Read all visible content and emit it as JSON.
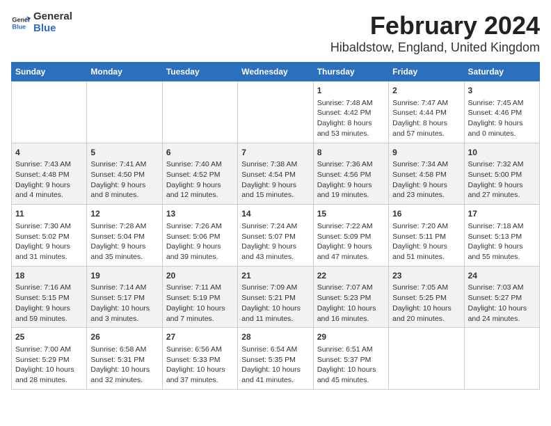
{
  "logo": {
    "line1": "General",
    "line2": "Blue"
  },
  "title": "February 2024",
  "subtitle": "Hibaldstow, England, United Kingdom",
  "days_of_week": [
    "Sunday",
    "Monday",
    "Tuesday",
    "Wednesday",
    "Thursday",
    "Friday",
    "Saturday"
  ],
  "weeks": [
    [
      {
        "day": "",
        "info": ""
      },
      {
        "day": "",
        "info": ""
      },
      {
        "day": "",
        "info": ""
      },
      {
        "day": "",
        "info": ""
      },
      {
        "day": "1",
        "info": "Sunrise: 7:48 AM\nSunset: 4:42 PM\nDaylight: 8 hours\nand 53 minutes."
      },
      {
        "day": "2",
        "info": "Sunrise: 7:47 AM\nSunset: 4:44 PM\nDaylight: 8 hours\nand 57 minutes."
      },
      {
        "day": "3",
        "info": "Sunrise: 7:45 AM\nSunset: 4:46 PM\nDaylight: 9 hours\nand 0 minutes."
      }
    ],
    [
      {
        "day": "4",
        "info": "Sunrise: 7:43 AM\nSunset: 4:48 PM\nDaylight: 9 hours\nand 4 minutes."
      },
      {
        "day": "5",
        "info": "Sunrise: 7:41 AM\nSunset: 4:50 PM\nDaylight: 9 hours\nand 8 minutes."
      },
      {
        "day": "6",
        "info": "Sunrise: 7:40 AM\nSunset: 4:52 PM\nDaylight: 9 hours\nand 12 minutes."
      },
      {
        "day": "7",
        "info": "Sunrise: 7:38 AM\nSunset: 4:54 PM\nDaylight: 9 hours\nand 15 minutes."
      },
      {
        "day": "8",
        "info": "Sunrise: 7:36 AM\nSunset: 4:56 PM\nDaylight: 9 hours\nand 19 minutes."
      },
      {
        "day": "9",
        "info": "Sunrise: 7:34 AM\nSunset: 4:58 PM\nDaylight: 9 hours\nand 23 minutes."
      },
      {
        "day": "10",
        "info": "Sunrise: 7:32 AM\nSunset: 5:00 PM\nDaylight: 9 hours\nand 27 minutes."
      }
    ],
    [
      {
        "day": "11",
        "info": "Sunrise: 7:30 AM\nSunset: 5:02 PM\nDaylight: 9 hours\nand 31 minutes."
      },
      {
        "day": "12",
        "info": "Sunrise: 7:28 AM\nSunset: 5:04 PM\nDaylight: 9 hours\nand 35 minutes."
      },
      {
        "day": "13",
        "info": "Sunrise: 7:26 AM\nSunset: 5:06 PM\nDaylight: 9 hours\nand 39 minutes."
      },
      {
        "day": "14",
        "info": "Sunrise: 7:24 AM\nSunset: 5:07 PM\nDaylight: 9 hours\nand 43 minutes."
      },
      {
        "day": "15",
        "info": "Sunrise: 7:22 AM\nSunset: 5:09 PM\nDaylight: 9 hours\nand 47 minutes."
      },
      {
        "day": "16",
        "info": "Sunrise: 7:20 AM\nSunset: 5:11 PM\nDaylight: 9 hours\nand 51 minutes."
      },
      {
        "day": "17",
        "info": "Sunrise: 7:18 AM\nSunset: 5:13 PM\nDaylight: 9 hours\nand 55 minutes."
      }
    ],
    [
      {
        "day": "18",
        "info": "Sunrise: 7:16 AM\nSunset: 5:15 PM\nDaylight: 9 hours\nand 59 minutes."
      },
      {
        "day": "19",
        "info": "Sunrise: 7:14 AM\nSunset: 5:17 PM\nDaylight: 10 hours\nand 3 minutes."
      },
      {
        "day": "20",
        "info": "Sunrise: 7:11 AM\nSunset: 5:19 PM\nDaylight: 10 hours\nand 7 minutes."
      },
      {
        "day": "21",
        "info": "Sunrise: 7:09 AM\nSunset: 5:21 PM\nDaylight: 10 hours\nand 11 minutes."
      },
      {
        "day": "22",
        "info": "Sunrise: 7:07 AM\nSunset: 5:23 PM\nDaylight: 10 hours\nand 16 minutes."
      },
      {
        "day": "23",
        "info": "Sunrise: 7:05 AM\nSunset: 5:25 PM\nDaylight: 10 hours\nand 20 minutes."
      },
      {
        "day": "24",
        "info": "Sunrise: 7:03 AM\nSunset: 5:27 PM\nDaylight: 10 hours\nand 24 minutes."
      }
    ],
    [
      {
        "day": "25",
        "info": "Sunrise: 7:00 AM\nSunset: 5:29 PM\nDaylight: 10 hours\nand 28 minutes."
      },
      {
        "day": "26",
        "info": "Sunrise: 6:58 AM\nSunset: 5:31 PM\nDaylight: 10 hours\nand 32 minutes."
      },
      {
        "day": "27",
        "info": "Sunrise: 6:56 AM\nSunset: 5:33 PM\nDaylight: 10 hours\nand 37 minutes."
      },
      {
        "day": "28",
        "info": "Sunrise: 6:54 AM\nSunset: 5:35 PM\nDaylight: 10 hours\nand 41 minutes."
      },
      {
        "day": "29",
        "info": "Sunrise: 6:51 AM\nSunset: 5:37 PM\nDaylight: 10 hours\nand 45 minutes."
      },
      {
        "day": "",
        "info": ""
      },
      {
        "day": "",
        "info": ""
      }
    ]
  ]
}
